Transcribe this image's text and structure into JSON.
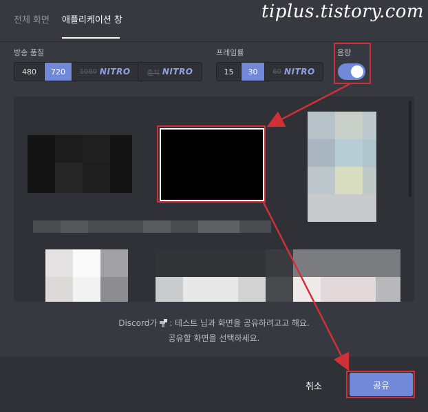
{
  "tabs": {
    "full_screen": "전체 화면",
    "application_window": "애플리케이션 창",
    "active": "애플리케이션 창"
  },
  "watermark": "tiplus.tistory.com",
  "stream_quality": {
    "label": "방송 품질",
    "options": [
      {
        "text": "480"
      },
      {
        "text": "720",
        "selected": true
      },
      {
        "text": "1080",
        "badge": "NITRO",
        "disabled": true
      },
      {
        "text": "출처",
        "badge": "NITRO",
        "disabled": true
      }
    ]
  },
  "frame_rate": {
    "label": "프레임률",
    "options": [
      {
        "text": "15"
      },
      {
        "text": "30",
        "selected": true
      },
      {
        "text": "60",
        "badge": "NITRO",
        "disabled": true
      }
    ]
  },
  "volume": {
    "label": "음량",
    "enabled": true
  },
  "message": {
    "line1_prefix": "Discord가",
    "line1_suffix": ": 테스트 님과 화면을 공유하려고고 해요.",
    "line2": "공유할 화면을 선택하세요."
  },
  "footer": {
    "cancel_label": "취소",
    "share_label": "공유"
  },
  "colors": {
    "accent": "#7289da",
    "highlight": "#d03038",
    "background": "#36393f"
  }
}
